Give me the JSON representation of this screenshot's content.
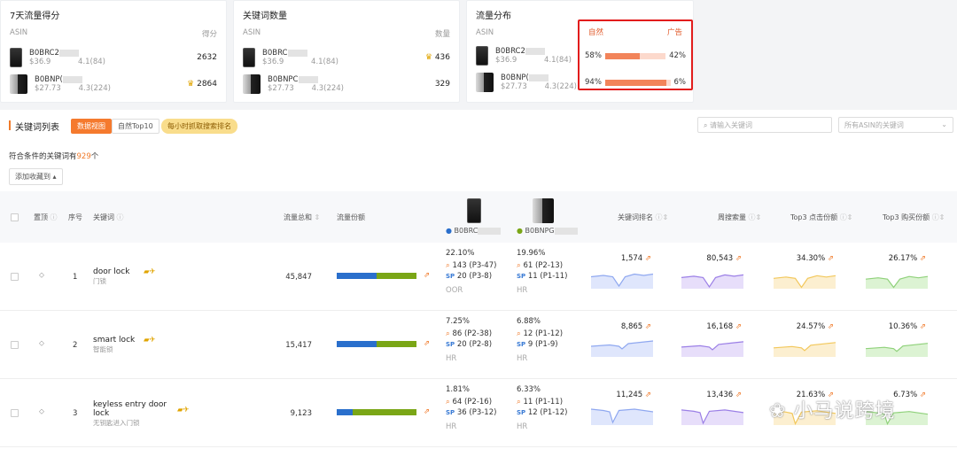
{
  "cards": [
    {
      "title": "7天流量得分",
      "col1": "ASIN",
      "col2": "得分",
      "rows": [
        {
          "asin": "B0BRC2",
          "price": "$36.9",
          "rating": "4.1(84)",
          "value": "2632",
          "crown": false,
          "thumb": "a"
        },
        {
          "asin": "B0BNP(",
          "price": "$27.73",
          "rating": "4.3(224)",
          "value": "2864",
          "crown": true,
          "thumb": "b"
        }
      ]
    },
    {
      "title": "关键词数量",
      "col1": "ASIN",
      "col2": "数量",
      "rows": [
        {
          "asin": "B0BRC",
          "price": "$36.9",
          "rating": "4.1(84)",
          "value": "436",
          "crown": true,
          "thumb": "a"
        },
        {
          "asin": "B0BNPC",
          "price": "$27.73",
          "rating": "4.3(224)",
          "value": "329",
          "crown": false,
          "thumb": "b"
        }
      ]
    },
    {
      "title": "流量分布",
      "col1": "ASIN",
      "col2": "",
      "rows": [
        {
          "asin": "B0BRC2",
          "price": "$36.9",
          "rating": "4.1(84)",
          "thumb": "a"
        },
        {
          "asin": "B0BNP(",
          "price": "$27.73",
          "rating": "4.3(224)",
          "thumb": "b"
        }
      ]
    }
  ],
  "distribution": {
    "natural_label": "自然",
    "ad_label": "广告",
    "rows": [
      {
        "natural": "58%",
        "ad": "42%",
        "natural_frac": 0.58
      },
      {
        "natural": "94%",
        "ad": "6%",
        "natural_frac": 0.94
      }
    ]
  },
  "section": {
    "title": "关键词列表",
    "tab_data": "数据视图",
    "tab_top10": "自然Top10",
    "hourly": "每小时抓取搜索排名",
    "search_placeholder": "请输入关键词",
    "asin_select": "所有ASIN的关键词",
    "count_prefix": "符合条件的关键词有",
    "count": "929",
    "count_suffix": "个",
    "add_fav": "添加收藏到"
  },
  "columns": {
    "pin": "置顶",
    "index": "序号",
    "keyword": "关键词",
    "traffic_total": "流量总和",
    "traffic_share": "流量份额",
    "asin1": "B0BRC",
    "asin2": "B0BNPG",
    "rank": "关键词排名",
    "weekly_search": "周搜索量",
    "top3_click": "Top3 点击份额",
    "top3_buy": "Top3 购买份额"
  },
  "rows": [
    {
      "index": "1",
      "keyword": "door lock",
      "keyword_cn": "门锁",
      "traffic": "45,847",
      "share_blue": 0.5,
      "a1": {
        "pct": "22.10%",
        "q": "143 (P3-47)",
        "sp": "20 (P3-8)",
        "tag": "OOR"
      },
      "a2": {
        "pct": "19.96%",
        "q": "61 (P2-13)",
        "sp": "11 (P1-11)",
        "tag": "HR"
      },
      "rank": "1,574",
      "weekly": "80,543",
      "click": "34.30%",
      "buy": "26.17%"
    },
    {
      "index": "2",
      "keyword": "smart lock",
      "keyword_cn": "智能锁",
      "traffic": "15,417",
      "share_blue": 0.5,
      "a1": {
        "pct": "7.25%",
        "q": "86 (P2-38)",
        "sp": "20 (P2-8)",
        "tag": "HR"
      },
      "a2": {
        "pct": "6.88%",
        "q": "12 (P1-12)",
        "sp": "9 (P1-9)",
        "tag": "HR"
      },
      "rank": "8,865",
      "weekly": "16,168",
      "click": "24.57%",
      "buy": "10.36%"
    },
    {
      "index": "3",
      "keyword": "keyless entry door lock",
      "keyword_cn": "无钥匙进入门锁",
      "traffic": "9,123",
      "share_blue": 0.2,
      "a1": {
        "pct": "1.81%",
        "q": "64 (P2-16)",
        "sp": "36 (P3-12)",
        "tag": "HR"
      },
      "a2": {
        "pct": "6.33%",
        "q": "11 (P1-11)",
        "sp": "12 (P1-12)",
        "tag": "HR"
      },
      "rank": "11,245",
      "weekly": "13,436",
      "click": "21.63%",
      "buy": "6.73%"
    }
  ],
  "watermark": "小马说跨境",
  "colors": {
    "accent": "#f57a2e",
    "blue": "#2a6fcc",
    "green": "#7aa616",
    "red_box": "#e21c1c"
  }
}
